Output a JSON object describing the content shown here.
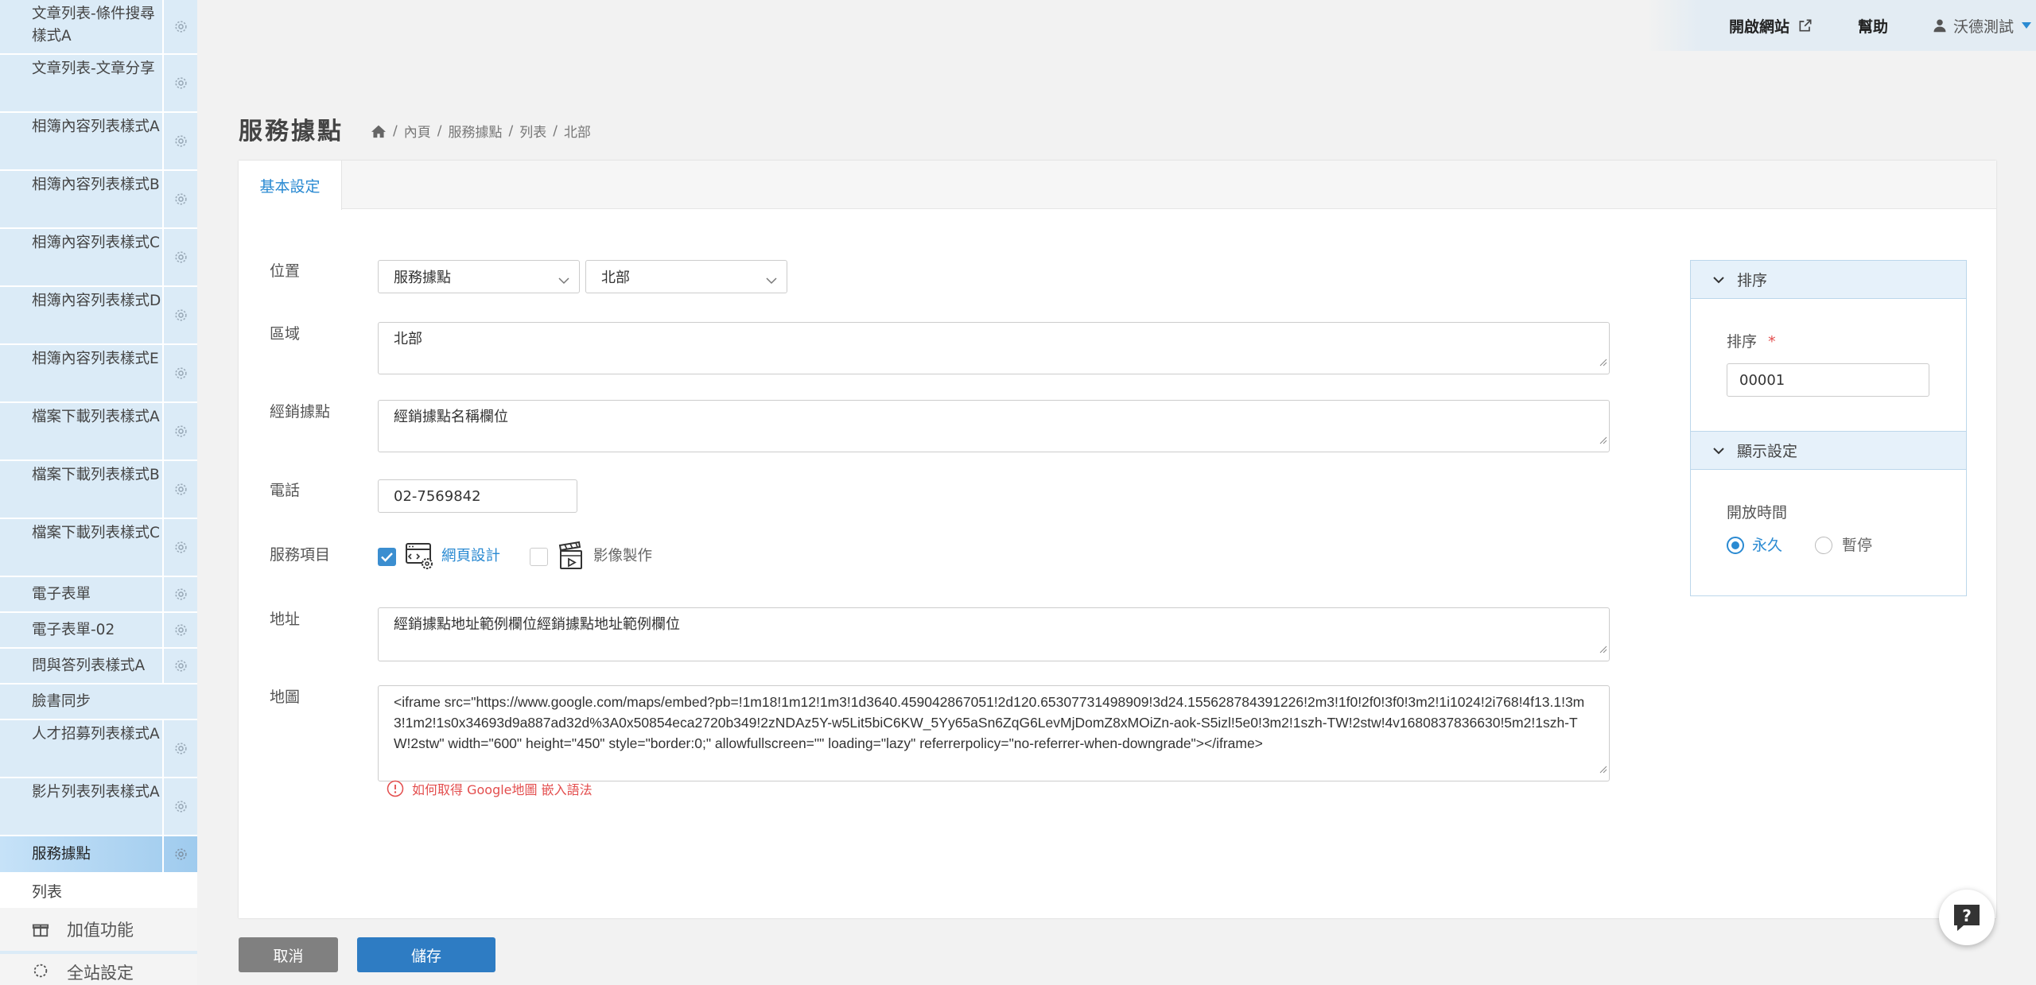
{
  "sidebar": {
    "items": [
      {
        "label": "文章列表-條件搜尋樣式A"
      },
      {
        "label": "文章列表-文章分享"
      },
      {
        "label": "相簿內容列表樣式A"
      },
      {
        "label": "相簿內容列表樣式B"
      },
      {
        "label": "相簿內容列表樣式C"
      },
      {
        "label": "相簿內容列表樣式D"
      },
      {
        "label": "相簿內容列表樣式E"
      },
      {
        "label": "檔案下載列表樣式A"
      },
      {
        "label": "檔案下載列表樣式B"
      },
      {
        "label": "檔案下載列表樣式C"
      },
      {
        "label": "電子表單"
      },
      {
        "label": "電子表單-02"
      },
      {
        "label": "問與答列表樣式A"
      },
      {
        "label": "臉書同步"
      },
      {
        "label": "人才招募列表樣式A"
      },
      {
        "label": "影片列表列表樣式A"
      },
      {
        "label": "服務據點"
      }
    ],
    "sub_item": "列表",
    "addon_label": "加值功能",
    "next_label": "全站設定"
  },
  "topbar": {
    "open_site": "開啟網站",
    "help": "幫助",
    "user": "沃德測試"
  },
  "page": {
    "title": "服務據點",
    "breadcrumb": [
      "內頁",
      "服務據點",
      "列表",
      "北部"
    ]
  },
  "tabs": [
    "基本設定"
  ],
  "form": {
    "location_label": "位置",
    "location_select1": "服務據點",
    "location_select2": "北部",
    "region_label": "區域",
    "region_value": "北部",
    "dealer_label": "經銷據點",
    "dealer_value": "經銷據點名稱欄位",
    "phone_label": "電話",
    "phone_value": "02-7569842",
    "services_label": "服務項目",
    "services": [
      {
        "label": "網頁設計",
        "checked": true
      },
      {
        "label": "影像製作",
        "checked": false
      }
    ],
    "address_label": "地址",
    "address_value": "經銷據點地址範例欄位經銷據點地址範例欄位",
    "map_label": "地圖",
    "map_value": "<iframe src=\"https://www.google.com/maps/embed?pb=!1m18!1m12!1m3!1d3640.459042867051!2d120.65307731498909!3d24.155628784391226!2m3!1f0!2f0!3f0!3m2!1i1024!2i768!4f13.1!3m3!1m2!1s0x34693d9a887ad32d%3A0x50854eca2720b349!2zNDAz5Y-w5Lit5biC6KW_5Yy65aSn6ZqG6LevMjDomZ8xMOiZn-aok-S5izl!5e0!3m2!1szh-TW!2stw!4v1680837836630!5m2!1szh-TW!2stw\" width=\"600\" height=\"450\" style=\"border:0;\" allowfullscreen=\"\" loading=\"lazy\" referrerpolicy=\"no-referrer-when-downgrade\"></iframe>",
    "map_hint": "如何取得 Google地圖 嵌入語法"
  },
  "side_panel": {
    "sort_header": "排序",
    "sort_label": "排序",
    "sort_required": "*",
    "sort_value": "00001",
    "display_header": "顯示設定",
    "open_time_label": "開放時間",
    "options": [
      {
        "label": "永久",
        "selected": true
      },
      {
        "label": "暫停",
        "selected": false
      }
    ]
  },
  "buttons": {
    "cancel": "取消",
    "save": "儲存"
  },
  "colors": {
    "accent": "#2a8ad2",
    "primary_button": "#2e7cc3",
    "cancel_button": "#808080",
    "sidebar_bg": "#dbebf7",
    "hint_red": "#e34d4d"
  }
}
